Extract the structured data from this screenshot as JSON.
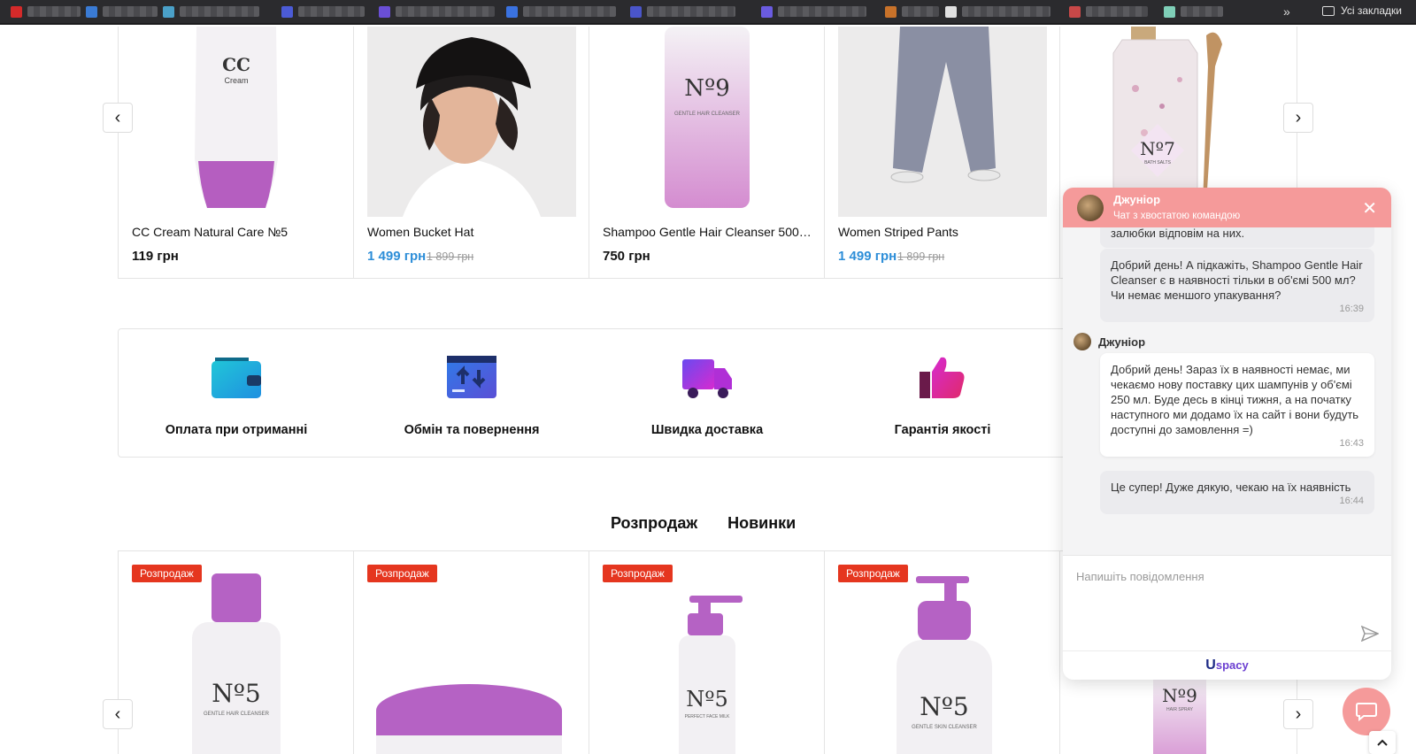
{
  "browser": {
    "bookmarks_more": "»",
    "all_bookmarks": "Усі закладки",
    "blurred_bookmarks": [
      {
        "favicon": "#d42a2a",
        "left": 0
      },
      {
        "favicon": "#3a7bd5"
      },
      {
        "favicon": "#4aa0c8"
      },
      {
        "favicon": "#4b5bd6"
      },
      {
        "favicon": "#6a4fd6"
      },
      {
        "favicon": "#3a72e0"
      },
      {
        "favicon": "#4a55c9"
      },
      {
        "favicon": "#6a5be0"
      },
      {
        "favicon": "#c8722a"
      },
      {
        "favicon": "#e0e0e0"
      },
      {
        "favicon": "#c84848"
      },
      {
        "favicon": "#7fcfb8"
      }
    ]
  },
  "top_products": [
    {
      "name": "CC Cream Natural Care №5",
      "price": "119 грн",
      "sale": false,
      "old_price": ""
    },
    {
      "name": "Women Bucket Hat",
      "price": "1 499 грн",
      "sale": true,
      "old_price": "1 899 грн"
    },
    {
      "name": "Shampoo Gentle Hair Cleanser 500 ml",
      "price": "750 грн",
      "sale": false,
      "old_price": ""
    },
    {
      "name": "Women Striped Pants",
      "price": "1 499 грн",
      "sale": true,
      "old_price": "1 899 грн"
    },
    {
      "name": "",
      "price": "",
      "sale": false,
      "old_price": ""
    }
  ],
  "product_labels": {
    "cc_title": "CC",
    "cc_sub": "Cream",
    "n9": "Nº9",
    "n9_sub": "GENTLE HAIR CLEANSER",
    "n7": "Nº7",
    "n7_sub": "BATH SALTS",
    "n5": "Nº5",
    "n5_sub_1": "GENTLE HAIR CLEANSER",
    "n5_sub_2": "PERFECT FACE MILK",
    "n5_sub_3": "GENTLE SKIN CLEANSER",
    "n9_spray": "Nº9",
    "n9_spray_sub": "HAIR SPRAY"
  },
  "features": [
    {
      "label": "Оплата при отриманні",
      "icon": "wallet-icon"
    },
    {
      "label": "Обмін та повернення",
      "icon": "exchange-icon"
    },
    {
      "label": "Швидка доставка",
      "icon": "truck-icon"
    },
    {
      "label": "Гарантія якості",
      "icon": "thumbs-up-icon"
    }
  ],
  "tabs": [
    "Розпродаж",
    "Новинки"
  ],
  "sale_badge": "Розпродаж",
  "chat": {
    "agent_name": "Джуніор",
    "subtitle": "Чат з хвостатою командою",
    "cut_text": "залюбки відповім на них.",
    "messages": [
      {
        "from": "user",
        "text": "Добрий день! А підкажіть, Shampoo Gentle Hair Cleanser є в наявності тільки в об'ємі 500 мл? Чи немає меншого упакування?",
        "time": "16:39"
      },
      {
        "from": "agent",
        "text": "Добрий день! Зараз їх в наявності немає, ми чекаємо нову поставку цих шампунів у об'ємі 250 мл. Буде десь в кінці тижня, а на початку наступного ми додамо їх на сайт і вони будуть доступні до замовлення =)",
        "time": "16:43"
      },
      {
        "from": "user",
        "text": "Це супер! Дуже дякую, чекаю на їх наявність",
        "time": "16:44"
      }
    ],
    "input_placeholder": "Напишіть повідомлення",
    "brand": "spacy",
    "brand_initial": "U"
  },
  "colors": {
    "accent_sale": "#2d8ed8",
    "badge": "#e5361f",
    "chat_header": "#f59a9a"
  }
}
